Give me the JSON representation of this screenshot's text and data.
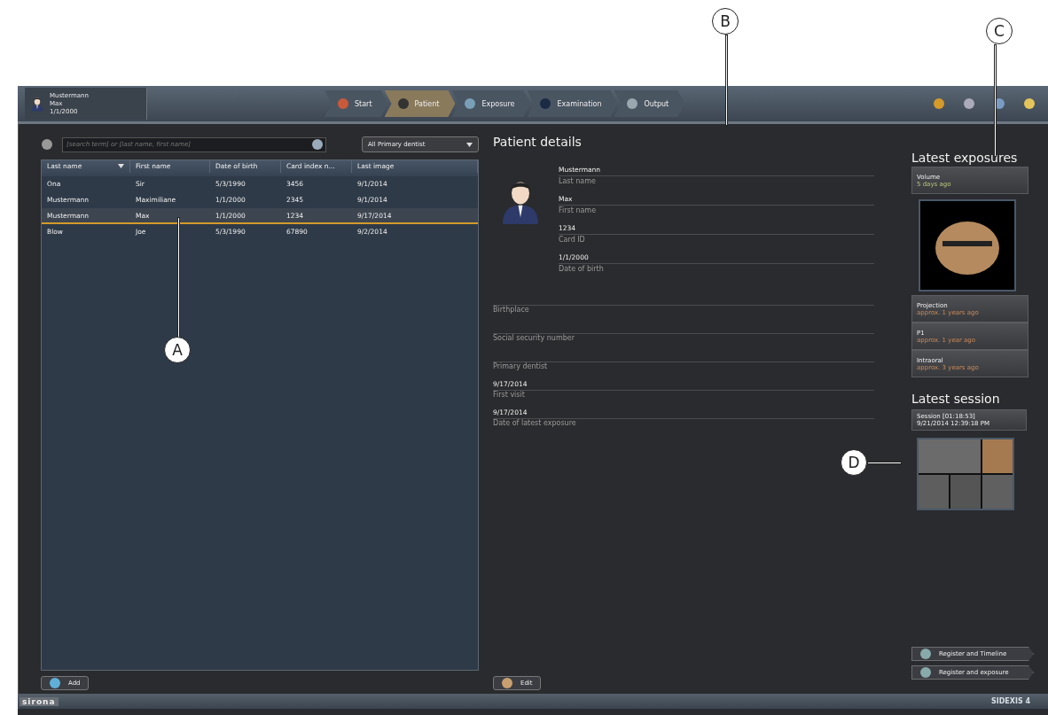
{
  "patient_badge": {
    "last_name": "Mustermann",
    "first_name": "Max",
    "date_of_birth": "1/1/2000"
  },
  "workflow_tabs": [
    {
      "label": "Start",
      "selected": false
    },
    {
      "label": "Patient",
      "selected": true
    },
    {
      "label": "Exposure",
      "selected": false
    },
    {
      "label": "Examination",
      "selected": false
    },
    {
      "label": "Output",
      "selected": false
    }
  ],
  "search": {
    "placeholder": "[search term] or [last name, first name]"
  },
  "dentist_filter": {
    "value": "All Primary dentist"
  },
  "table": {
    "columns": [
      {
        "label": "Last name",
        "sorted": true
      },
      {
        "label": "First name",
        "sorted": false
      },
      {
        "label": "Date of birth",
        "sorted": false
      },
      {
        "label": "Card index n...",
        "sorted": false
      },
      {
        "label": "Last image",
        "sorted": false
      }
    ],
    "rows": [
      {
        "cells": [
          "Ona",
          "Sir",
          "5/3/1990",
          "3456",
          "9/1/2014"
        ],
        "selected": false
      },
      {
        "cells": [
          "Mustermann",
          "Maximiliane",
          "1/1/2000",
          "2345",
          "9/1/2014"
        ],
        "selected": false
      },
      {
        "cells": [
          "Mustermann",
          "Max",
          "1/1/2000",
          "1234",
          "9/17/2014"
        ],
        "selected": true
      },
      {
        "cells": [
          "Blow",
          "Joe",
          "5/3/1990",
          "67890",
          "9/2/2014"
        ],
        "selected": false
      }
    ]
  },
  "add_button": "Add",
  "details": {
    "title": "Patient details",
    "main_fields": [
      {
        "value": "Mustermann",
        "label": "Last name"
      },
      {
        "value": "Max",
        "label": "First name"
      },
      {
        "value": "1234",
        "label": "Card ID"
      },
      {
        "value": "1/1/2000",
        "label": "Date of birth"
      }
    ],
    "other_fields": [
      {
        "label": "Birthplace"
      },
      {
        "label": "Social security number"
      },
      {
        "label": "Primary dentist"
      },
      {
        "value": "9/17/2014",
        "label": "First visit"
      },
      {
        "value": "9/17/2014",
        "label": "Date of latest exposure"
      }
    ]
  },
  "edit_button": "Edit",
  "latest_exposures": {
    "title": "Latest exposures",
    "items": [
      {
        "name": "Volume",
        "age": "5 days ago",
        "recent": true,
        "expanded": true
      },
      {
        "name": "Projection",
        "age": "approx. 1 years ago",
        "recent": false,
        "expanded": false
      },
      {
        "name": "P1",
        "age": "approx. 1 year ago",
        "recent": false,
        "expanded": false
      },
      {
        "name": "Intraoral",
        "age": "approx. 3 years ago",
        "recent": false,
        "expanded": false
      }
    ]
  },
  "latest_session": {
    "title": "Latest session",
    "name": "Session [01:18:53]",
    "date": "9/21/2014 12:39:18 PM"
  },
  "action_buttons": [
    "Register and Timeline",
    "Register and exposure"
  ],
  "status_bar": {
    "brand": "sirona",
    "product": "SIDEXIS 4"
  },
  "callouts": [
    "A",
    "B",
    "C",
    "D"
  ]
}
